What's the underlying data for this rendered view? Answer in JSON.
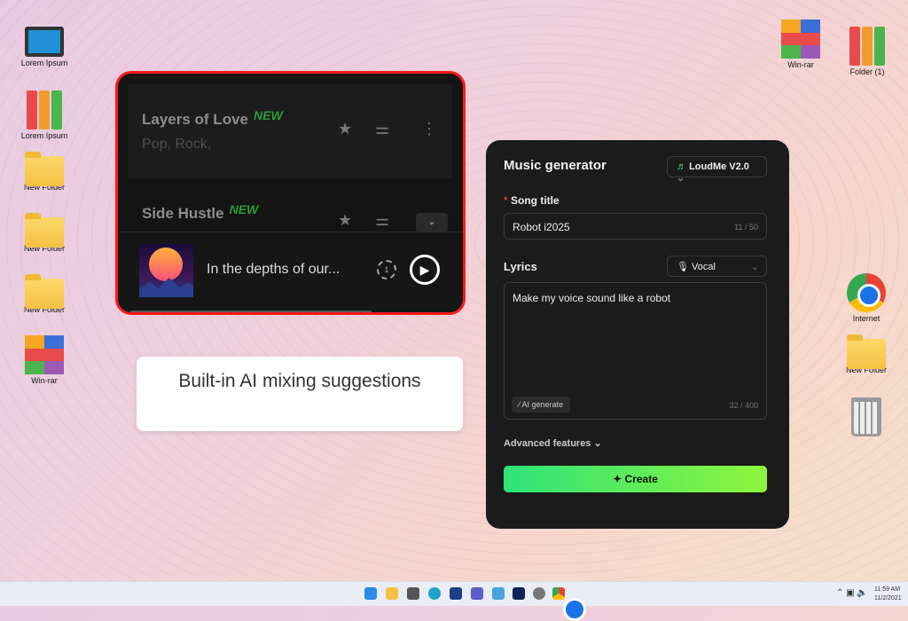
{
  "desktop": {
    "left_icons": [
      "Lorem Ipsum",
      "Lorem Ipsum",
      "New Folder",
      "New Folder",
      "New Folder",
      "Win-rar"
    ],
    "right_top_icons": [
      "Win-rar",
      "Folder (1)"
    ],
    "right_bottom_icons": [
      "Internet",
      "New Folder"
    ]
  },
  "player": {
    "songs": [
      {
        "title": "Layers of Love",
        "badge": "NEW",
        "genres": "Pop, Rock,"
      },
      {
        "title": "Side Hustle",
        "badge": "NEW"
      }
    ],
    "now_playing": "In the depths of our...",
    "loop_count": "1"
  },
  "caption": "Built-in AI mixing suggestions",
  "generator": {
    "title": "Music generator",
    "model": "LoudMe V2.0",
    "song_title_label": "Song title",
    "song_title_value": "Robot i2025",
    "song_title_count": "11 / 50",
    "lyrics_label": "Lyrics",
    "lyrics_mode": "Vocal",
    "lyrics_value": "Make my voice sound like a robot",
    "ai_generate": "AI generate",
    "lyrics_count": "32 / 400",
    "advanced": "Advanced features",
    "create": "Create",
    "accent": "#4ade80"
  },
  "taskbar": {
    "time": "11:59 AM",
    "date": "11/2/2021"
  }
}
